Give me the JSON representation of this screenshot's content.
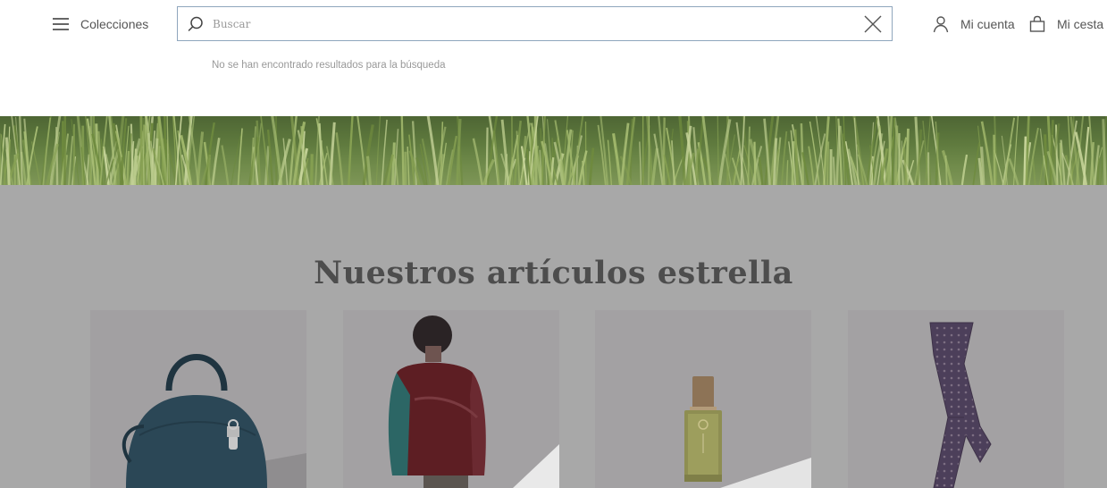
{
  "header": {
    "menu_label": "Colecciones",
    "search": {
      "placeholder": "Buscar",
      "value": "",
      "no_results": "No se han encontrado resultados para la búsqueda"
    },
    "account_label": "Mi cuenta",
    "cart_label": "Mi cesta"
  },
  "featured": {
    "title": "Nuestros artículos estrella",
    "products": [
      {
        "icon": "handbag-image"
      },
      {
        "icon": "jacket-model-image"
      },
      {
        "icon": "perfume-bottle-image"
      },
      {
        "icon": "silk-tie-image"
      }
    ]
  },
  "colors": {
    "search_border": "#8fa6bd",
    "overlay_gray": "#a8a8a8",
    "text_gray": "#555555"
  }
}
